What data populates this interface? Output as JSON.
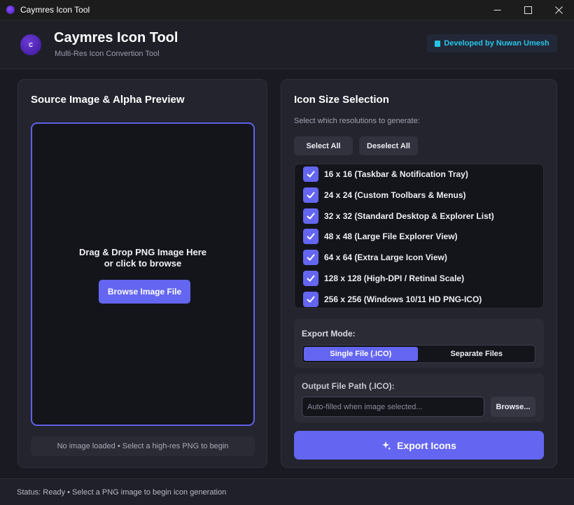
{
  "window": {
    "title": "Caymres Icon Tool",
    "controls": {
      "minimize": "—",
      "maximize": "☐",
      "close": "✕"
    }
  },
  "header": {
    "logo_letter": "C",
    "title": "Caymres Icon Tool",
    "subtitle": "Multi-Res Icon Convertion Tool",
    "developer_badge": "Developed by Nuwan Umesh"
  },
  "source_panel": {
    "title": "Source Image & Alpha Preview",
    "drop_text_line1": "Drag & Drop PNG Image Here",
    "drop_text_line2": "or click to browse",
    "browse_button": "Browse Image File",
    "status": "No image loaded • Select a high-res PNG to begin"
  },
  "size_panel": {
    "title": "Icon Size Selection",
    "hint": "Select which resolutions to generate:",
    "select_all": "Select All",
    "deselect_all": "Deselect All",
    "sizes": [
      {
        "label": "16 x 16 (Taskbar & Notification Tray)",
        "checked": true
      },
      {
        "label": "24 x 24 (Custom Toolbars & Menus)",
        "checked": true
      },
      {
        "label": "32 x 32 (Standard Desktop & Explorer List)",
        "checked": true
      },
      {
        "label": "48 x 48 (Large File Explorer View)",
        "checked": true
      },
      {
        "label": "64 x 64 (Extra Large Icon View)",
        "checked": true
      },
      {
        "label": "128 x 128 (High-DPI / Retinal Scale)",
        "checked": true
      },
      {
        "label": "256 x 256 (Windows 10/11 HD PNG-ICO)",
        "checked": true
      }
    ],
    "export_mode": {
      "label": "Export Mode:",
      "options": [
        "Single File (.ICO)",
        "Separate Files"
      ],
      "selected": "Single File (.ICO)"
    },
    "output": {
      "label": "Output File Path (.ICO):",
      "value": "",
      "placeholder": "Auto-filled when image selected...",
      "browse": "Browse..."
    },
    "export_button": "Export Icons"
  },
  "statusbar": {
    "text": "Status: Ready • Select a PNG image to begin icon generation"
  },
  "colors": {
    "accent": "#6466f1",
    "badge_text": "#27c4e8",
    "background": "#1a1b22",
    "panel": "#23242d"
  }
}
